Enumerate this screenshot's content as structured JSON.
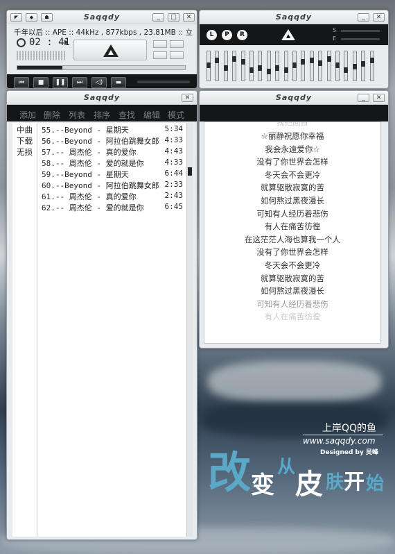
{
  "player": {
    "title": "Saqqdy",
    "now_playing": "千年以后 :: APE :: 44kHz , 877kbps , 23.81MB :: 立",
    "time": "02 : 41",
    "controls": [
      "prev",
      "stop",
      "pause",
      "next",
      "mute",
      "folder"
    ],
    "progress": 0.27
  },
  "eq": {
    "title": "Saqqdy",
    "buttons": [
      "L",
      "P",
      "R"
    ],
    "side_labels": [
      "S",
      "E"
    ],
    "levels": [
      0.55,
      0.75,
      0.45,
      0.8,
      0.7,
      0.35,
      0.45,
      0.3,
      0.45,
      0.35,
      0.55,
      0.7,
      0.75,
      0.65,
      0.8,
      0.55,
      0.35,
      0.5,
      0.6,
      0.75
    ]
  },
  "playlist": {
    "title": "Saqqdy",
    "menu": [
      "添加",
      "删除",
      "列表",
      "排序",
      "查找",
      "编辑",
      "模式"
    ],
    "categories": [
      "中曲",
      "下载",
      "无损"
    ],
    "tracks": [
      {
        "label": "55.--Beyond - 星期天",
        "duration": "5:34"
      },
      {
        "label": "56.--Beyond - 阿拉伯跳舞女郎",
        "duration": "4:33"
      },
      {
        "label": "57.-- 周杰伦 - 真的爱你",
        "duration": "4:43"
      },
      {
        "label": "58.-- 周杰伦 - 爱的就是你",
        "duration": "4:33"
      },
      {
        "label": "59.--Beyond - 星期天",
        "duration": "6:44"
      },
      {
        "label": "60.--Beyond - 阿拉伯跳舞女郎",
        "duration": "2:33"
      },
      {
        "label": "61.-- 周杰伦 - 真的爱你",
        "duration": "2:43"
      },
      {
        "label": "62.-- 周杰伦 - 爱的就是你",
        "duration": "6:45"
      }
    ]
  },
  "lyrics": {
    "title": "Saqqdy",
    "partial_top": "我把回首",
    "lines": [
      "☆丽静祝愿你幸福",
      "我会永遠爱你☆",
      "没有了你世界会怎样",
      "冬天会不会更冷",
      "就算驱散寂寞的苦",
      "如何熬过黑夜漫长",
      "可知有人经历着悲伤",
      "有人在痛苦彷徨",
      "在这茫茫人海也算我一个人",
      "没有了你世界会怎样",
      "冬天会不会更冷",
      "就算驱散寂寞的苦",
      "如何熬过黑夜漫长",
      "可知有人经历着悲伤"
    ],
    "partial_bottom": "有人在痛苦彷徨"
  },
  "brand": {
    "line1": "上岸QQ的鱼",
    "url": "www.saqqdy.com",
    "designed": "Designed by 吴峰",
    "slogan": [
      "改",
      "变",
      "从",
      "皮",
      "肤",
      "开",
      "始"
    ]
  },
  "colors": {
    "dark": "#151618",
    "menu_text": "#7a7e83",
    "accent": "#5aa9c9"
  }
}
